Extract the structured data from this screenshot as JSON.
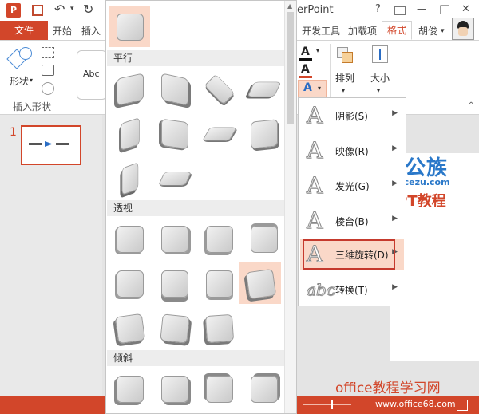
{
  "title": {
    "app_suffix": "erPoint"
  },
  "window": {
    "help": "?",
    "min": "—",
    "max": "□",
    "close": "✕"
  },
  "ribbon_tabs": {
    "file": "文件",
    "home": "开始",
    "insert": "插入",
    "developer": "开发工具",
    "addins": "加载项",
    "format": "格式",
    "user": "胡俊"
  },
  "left_ribbon": {
    "shape_label": "形状",
    "group_label": "插入形状",
    "textbox_label": "Abc"
  },
  "right_ribbon": {
    "arrange_label": "排列",
    "size_label": "大小"
  },
  "thumbnail": {
    "slide_number": "1"
  },
  "gallery": {
    "sections": [
      {
        "label": "平行"
      },
      {
        "label": "透视"
      },
      {
        "label": "倾斜"
      }
    ]
  },
  "submenu": {
    "items": [
      {
        "icon": "A",
        "label": "阴影(S)"
      },
      {
        "icon": "A",
        "label": "映像(R)"
      },
      {
        "icon": "A",
        "label": "发光(G)"
      },
      {
        "icon": "A",
        "label": "棱台(B)"
      },
      {
        "icon": "A",
        "label": "三维旋转(D)"
      },
      {
        "icon": "abc",
        "label": "转换(T)"
      }
    ]
  },
  "watermark": {
    "brand": "办公族",
    "site": "Officezu.com",
    "tagline": "PPT教程",
    "footer": "office教程学习网",
    "url": "www.office68.com"
  },
  "colors": {
    "accent": "#d2462a",
    "highlight": "#fad8c8",
    "selection_border": "#c53a2d"
  }
}
